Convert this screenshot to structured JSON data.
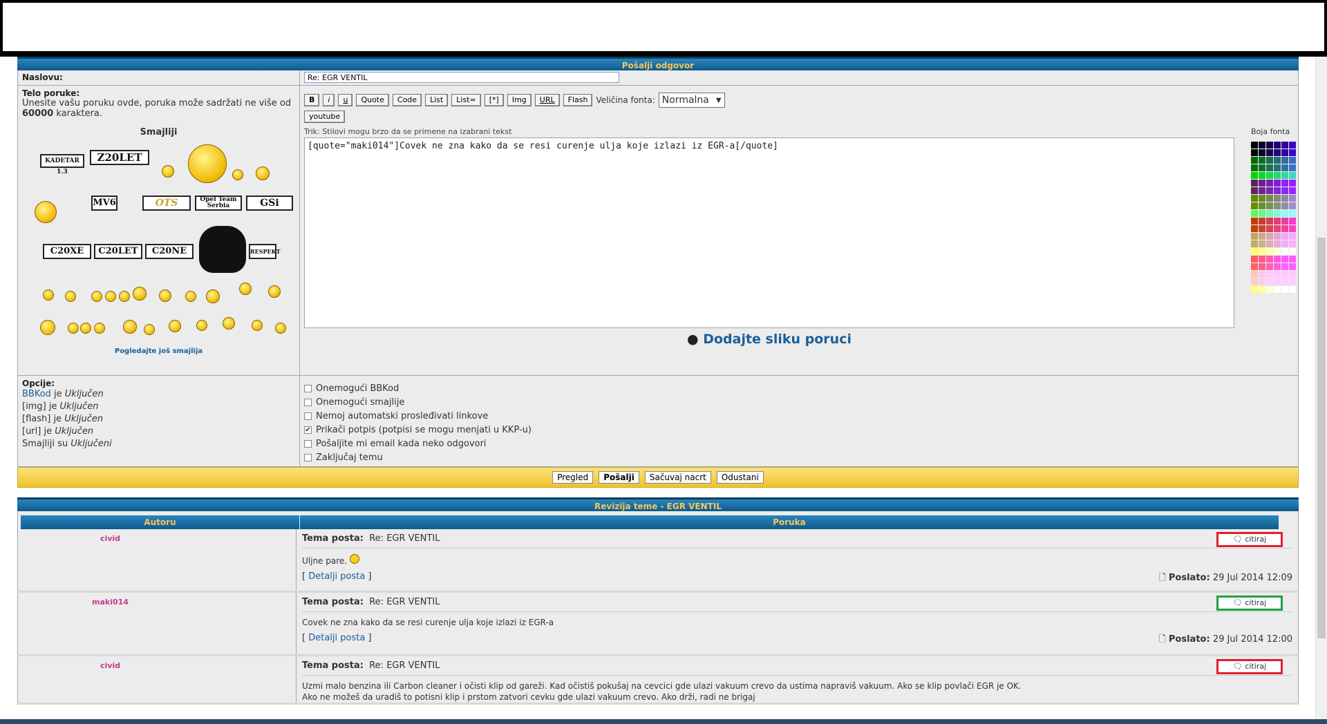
{
  "reply_header": "Pošalji odgovor",
  "subject": {
    "label": "Naslovu:",
    "value": "Re: EGR VENTIL"
  },
  "body": {
    "label": "Telo poruke:",
    "hint_pre": "Unesite vašu poruku ovde, poruka može sadržati ne više od ",
    "hint_num": "60000",
    "hint_post": " karaktera."
  },
  "smilies": {
    "title": "Smajliji",
    "more": "Pogledajte još smajlija",
    "signs": [
      "KADETAR 1.3",
      "Z20LET",
      "MV6",
      "OTS",
      "Opel Team Serbia",
      "GSi",
      "C20XE",
      "C20LET",
      "C20NE",
      "RESPEKT"
    ]
  },
  "toolbar": {
    "buttons": [
      "B",
      "i",
      "u",
      "Quote",
      "Code",
      "List",
      "List=",
      "[*]",
      "Img",
      "URL",
      "Flash"
    ],
    "font_size_label": "Veličina fonta:",
    "font_size_value": "Normalna",
    "youtube": "youtube",
    "tip": "Trik: Stilovi mogu brzo da se primene na izabrani tekst"
  },
  "message_text": "[quote=\"maki014\"]Covek ne zna kako da se resi curenje ulja koje izlazi iz EGR-a[/quote]",
  "add_image": "Dodajte sliku poruci",
  "font_color_label": "Boja fonta",
  "options": {
    "label": "Opcije:",
    "status": [
      {
        "name": "BBKod",
        "mid": " je ",
        "val": "Uključen"
      },
      {
        "name": "[img]",
        "mid": " je ",
        "val": "Uključen"
      },
      {
        "name": "[flash]",
        "mid": " je ",
        "val": "Uključen"
      },
      {
        "name": "[url]",
        "mid": " je ",
        "val": "Uključen"
      },
      {
        "name": "Smajliji",
        "mid": " su ",
        "val": "Uključeni"
      }
    ],
    "checks": [
      {
        "label": "Onemogući BBKod",
        "checked": false
      },
      {
        "label": "Onemogući smajlije",
        "checked": false
      },
      {
        "label": "Nemoj automatski prosleđivati linkove",
        "checked": false
      },
      {
        "label": "Prikači potpis (potpisi se mogu menjati u KKP-u)",
        "checked": true
      },
      {
        "label": "Pošaljite mi email kada neko odgovori",
        "checked": false
      },
      {
        "label": "Zaključaj temu",
        "checked": false
      }
    ]
  },
  "actions": [
    "Pregled",
    "Pošalji",
    "Sačuvaj nacrt",
    "Odustani"
  ],
  "review": {
    "header": "Revizija teme - EGR VENTIL",
    "col_author": "Autoru",
    "col_message": "Poruka",
    "posts": [
      {
        "author": "civid",
        "topic_label": "Tema posta:",
        "topic": "Re: EGR VENTIL",
        "cite": "citiraj",
        "cite_color": "#e0202a",
        "text": "Uljne pare.",
        "details": "Detalji posta",
        "posted_label": "Poslato:",
        "posted": "29 Jul 2014 12:09"
      },
      {
        "author": "maki014",
        "topic_label": "Tema posta:",
        "topic": "Re: EGR VENTIL",
        "cite": "citiraj",
        "cite_color": "#22a040",
        "text": "Covek ne zna kako da se resi curenje ulja koje izlazi iz EGR-a",
        "details": "Detalji posta",
        "posted_label": "Poslato:",
        "posted": "29 Jul 2014 12:00"
      },
      {
        "author": "civid",
        "topic_label": "Tema posta:",
        "topic": "Re: EGR VENTIL",
        "cite": "citiraj",
        "cite_color": "#e0202a",
        "text": "Uzmi malo benzina ili Carbon cleaner i očisti klip od gareži. Kad očistiš pokušaj na cevcici gde ulazi vakuum crevo da ustima napraviš vakuum. Ako se klip povlači EGR je OK.",
        "text2": "Ako ne možeš da uradiš to potisni klip i prstom zatvori cevku gde ulazi vakuum crevo. Ako drži, radi ne brigaj"
      }
    ]
  }
}
